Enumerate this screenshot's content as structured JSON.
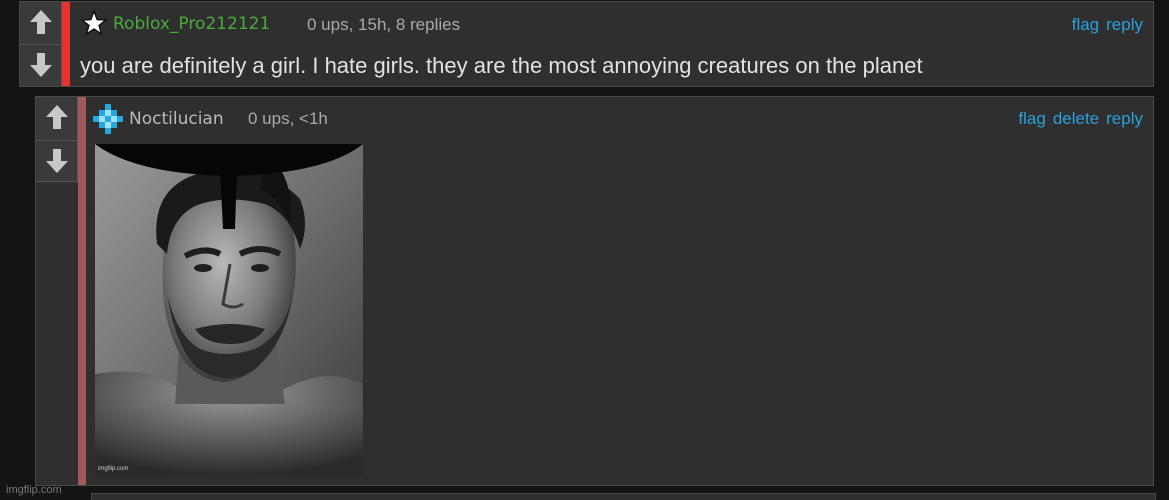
{
  "comments": [
    {
      "username": "Roblox_Pro212121",
      "meta": "0 ups, 15h, 8 replies",
      "actions": [
        "flag",
        "reply"
      ],
      "text": "you are definitely a girl. I hate girls. they are the most annoying creatures on the planet",
      "username_color": "#4caa3c",
      "stripe_color": "#e8322c",
      "badge_icon": "star-icon"
    },
    {
      "username": "Noctilucian",
      "meta": "0 ups, <1h",
      "actions": [
        "flag",
        "delete",
        "reply"
      ],
      "image_watermark": "imgflip.com",
      "username_color": "#b9b9b9",
      "stripe_color": "#a05a5a",
      "badge_icon": "pixel-diamond-icon"
    }
  ],
  "vote_icons": {
    "up": "arrow-up-icon",
    "down": "arrow-down-icon"
  },
  "link_color": "#2aa0dc",
  "watermark": "imgflip.com"
}
